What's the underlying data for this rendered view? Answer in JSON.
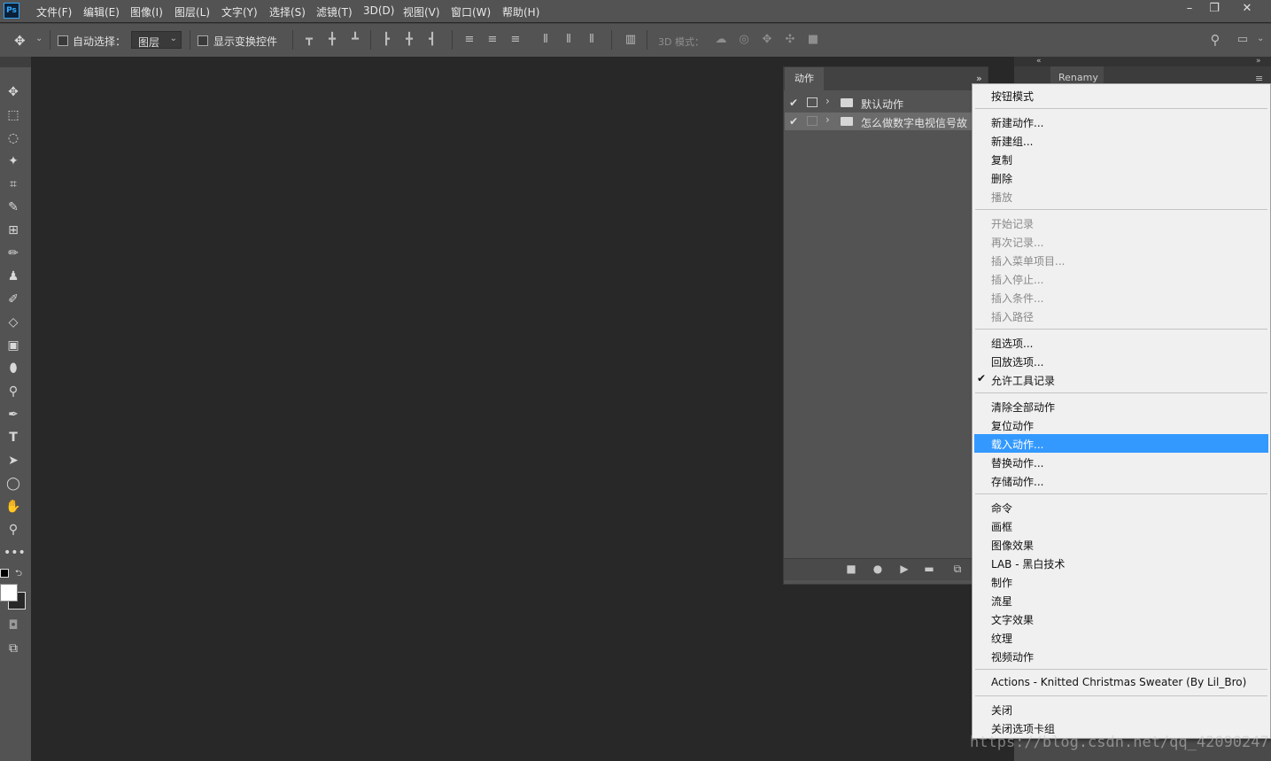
{
  "app": {
    "logo": "Ps"
  },
  "menubar": {
    "items": [
      "文件(F)",
      "编辑(E)",
      "图像(I)",
      "图层(L)",
      "文字(Y)",
      "选择(S)",
      "滤镜(T)",
      "3D(D)",
      "视图(V)",
      "窗口(W)",
      "帮助(H)"
    ],
    "window_buttons": {
      "minimize": "minimize-icon",
      "restore": "restore-icon",
      "close": "close-icon"
    }
  },
  "options_bar": {
    "auto_select_label": "自动选择：",
    "auto_select_value": "图层",
    "show_transform_label": "显示变换控件",
    "mode_3d_label": "3D 模式："
  },
  "actions_panel": {
    "tab_label": "动作",
    "rows": [
      {
        "label": "默认动作",
        "checked": true,
        "dialog": true
      },
      {
        "label": "怎么做数字电视信号故",
        "checked": true,
        "dialog": false
      }
    ]
  },
  "right_dock": {
    "tab_label": "Renamy"
  },
  "context_menu": {
    "groups": [
      [
        {
          "label": "按钮模式",
          "disabled": false
        }
      ],
      [
        {
          "label": "新建动作...",
          "disabled": false
        },
        {
          "label": "新建组...",
          "disabled": false
        },
        {
          "label": "复制",
          "disabled": false
        },
        {
          "label": "删除",
          "disabled": false
        },
        {
          "label": "播放",
          "disabled": true
        }
      ],
      [
        {
          "label": "开始记录",
          "disabled": true
        },
        {
          "label": "再次记录...",
          "disabled": true
        },
        {
          "label": "插入菜单项目...",
          "disabled": true
        },
        {
          "label": "插入停止...",
          "disabled": true
        },
        {
          "label": "插入条件...",
          "disabled": true
        },
        {
          "label": "插入路径",
          "disabled": true
        }
      ],
      [
        {
          "label": "组选项...",
          "disabled": false
        },
        {
          "label": "回放选项...",
          "disabled": false
        },
        {
          "label": "允许工具记录",
          "disabled": false,
          "checked": true
        }
      ],
      [
        {
          "label": "清除全部动作",
          "disabled": false
        },
        {
          "label": "复位动作",
          "disabled": false
        },
        {
          "label": "载入动作...",
          "disabled": false,
          "highlighted": true
        },
        {
          "label": "替换动作...",
          "disabled": false
        },
        {
          "label": "存储动作...",
          "disabled": false
        }
      ],
      [
        {
          "label": "命令",
          "disabled": false
        },
        {
          "label": "画框",
          "disabled": false
        },
        {
          "label": "图像效果",
          "disabled": false
        },
        {
          "label": "LAB - 黑白技术",
          "disabled": false
        },
        {
          "label": "制作",
          "disabled": false
        },
        {
          "label": "流星",
          "disabled": false
        },
        {
          "label": "文字效果",
          "disabled": false
        },
        {
          "label": "纹理",
          "disabled": false
        },
        {
          "label": "视频动作",
          "disabled": false
        }
      ],
      [
        {
          "label": "Actions - Knitted Christmas Sweater (By Lil_Bro)",
          "disabled": false
        }
      ],
      [
        {
          "label": "关闭",
          "disabled": false
        },
        {
          "label": "关闭选项卡组",
          "disabled": false
        }
      ]
    ]
  },
  "watermark": "https://blog.csdn.net/qq_42090247",
  "colors": {
    "highlight": "#3399ff",
    "chrome": "#535353",
    "canvas": "#282828"
  }
}
